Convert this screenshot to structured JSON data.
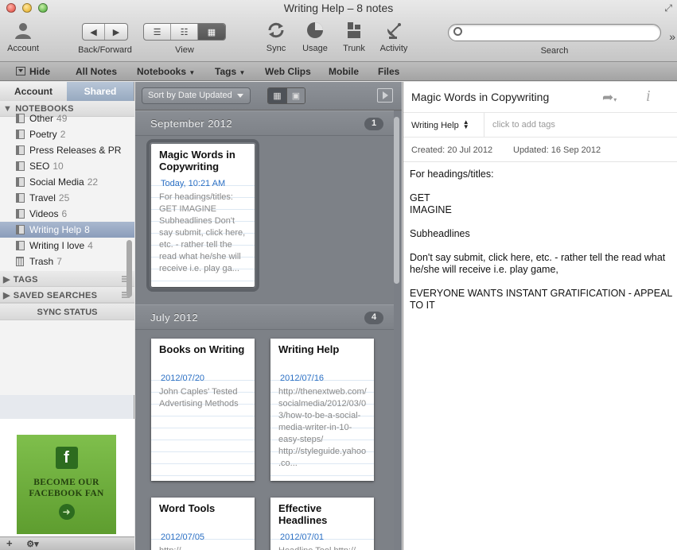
{
  "window": {
    "title": "Writing Help – 8 notes"
  },
  "toolbar": {
    "account": "Account",
    "back_forward": "Back/Forward",
    "view": "View",
    "sync": "Sync",
    "usage": "Usage",
    "trunk": "Trunk",
    "activity": "Activity",
    "search_label": "Search",
    "search_value": ""
  },
  "navbar": {
    "hide": "Hide",
    "all_notes": "All Notes",
    "notebooks": "Notebooks",
    "tags": "Tags",
    "web_clips": "Web Clips",
    "mobile": "Mobile",
    "files": "Files"
  },
  "sidebar": {
    "tab_account": "Account",
    "tab_shared": "Shared",
    "notebooks_header": "NOTEBOOKS",
    "notebooks": [
      {
        "name": "Other",
        "count": "49"
      },
      {
        "name": "Poetry",
        "count": "2"
      },
      {
        "name": "Press Releases & PR",
        "count": ""
      },
      {
        "name": "SEO",
        "count": "10"
      },
      {
        "name": "Social Media",
        "count": "22"
      },
      {
        "name": "Travel",
        "count": "25"
      },
      {
        "name": "Videos",
        "count": "6"
      },
      {
        "name": "Writing Help",
        "count": "8"
      },
      {
        "name": "Writing I love",
        "count": "4"
      }
    ],
    "trash": {
      "name": "Trash",
      "count": "7"
    },
    "tags_header": "TAGS",
    "saved_searches_header": "SAVED SEARCHES",
    "sync_status": "SYNC STATUS",
    "ad_text": "BECOME OUR FACEBOOK FAN",
    "bottom_add": "+",
    "bottom_gear": "⚙▾"
  },
  "notelist": {
    "sort_label": "Sort by Date Updated",
    "groups": [
      {
        "title": "September 2012",
        "count": "1",
        "notes": [
          {
            "title": "Magic Words in Copywriting",
            "date": "Today, 10:21 AM",
            "snippet": "For headings/titles: GET IMAGINE Subheadlines Don't say submit, click here, etc. - rather tell the read what he/she will receive i.e. play ga..."
          }
        ]
      },
      {
        "title": "July 2012",
        "count": "4",
        "notes": [
          {
            "title": "Books on Writing",
            "date": "2012/07/20",
            "snippet": "John Caples' Tested Advertising Methods"
          },
          {
            "title": "Writing Help",
            "date": "2012/07/16",
            "snippet": "http://thenextweb.com/socialmedia/2012/03/03/how-to-be-a-social-media-writer-in-10-easy-steps/ http://styleguide.yahoo.co..."
          },
          {
            "title": "Word Tools",
            "date": "2012/07/05",
            "snippet": "http://"
          },
          {
            "title": "Effective Headlines",
            "date": "2012/07/01",
            "snippet": "Headline Tool http://"
          }
        ]
      }
    ]
  },
  "editor": {
    "title": "Magic Words in Copywriting",
    "notebook": "Writing Help",
    "tags_placeholder": "click to add tags",
    "created": "Created: 20 Jul 2012",
    "updated": "Updated: 16 Sep 2012",
    "body": [
      "For headings/titles:",
      "",
      "GET",
      "IMAGINE",
      "",
      "Subheadlines",
      "",
      "Don't say submit, click here, etc. - rather tell the read what he/she will receive i.e. play game,",
      "",
      "EVERYONE WANTS INSTANT GRATIFICATION - APPEAL TO IT"
    ]
  }
}
